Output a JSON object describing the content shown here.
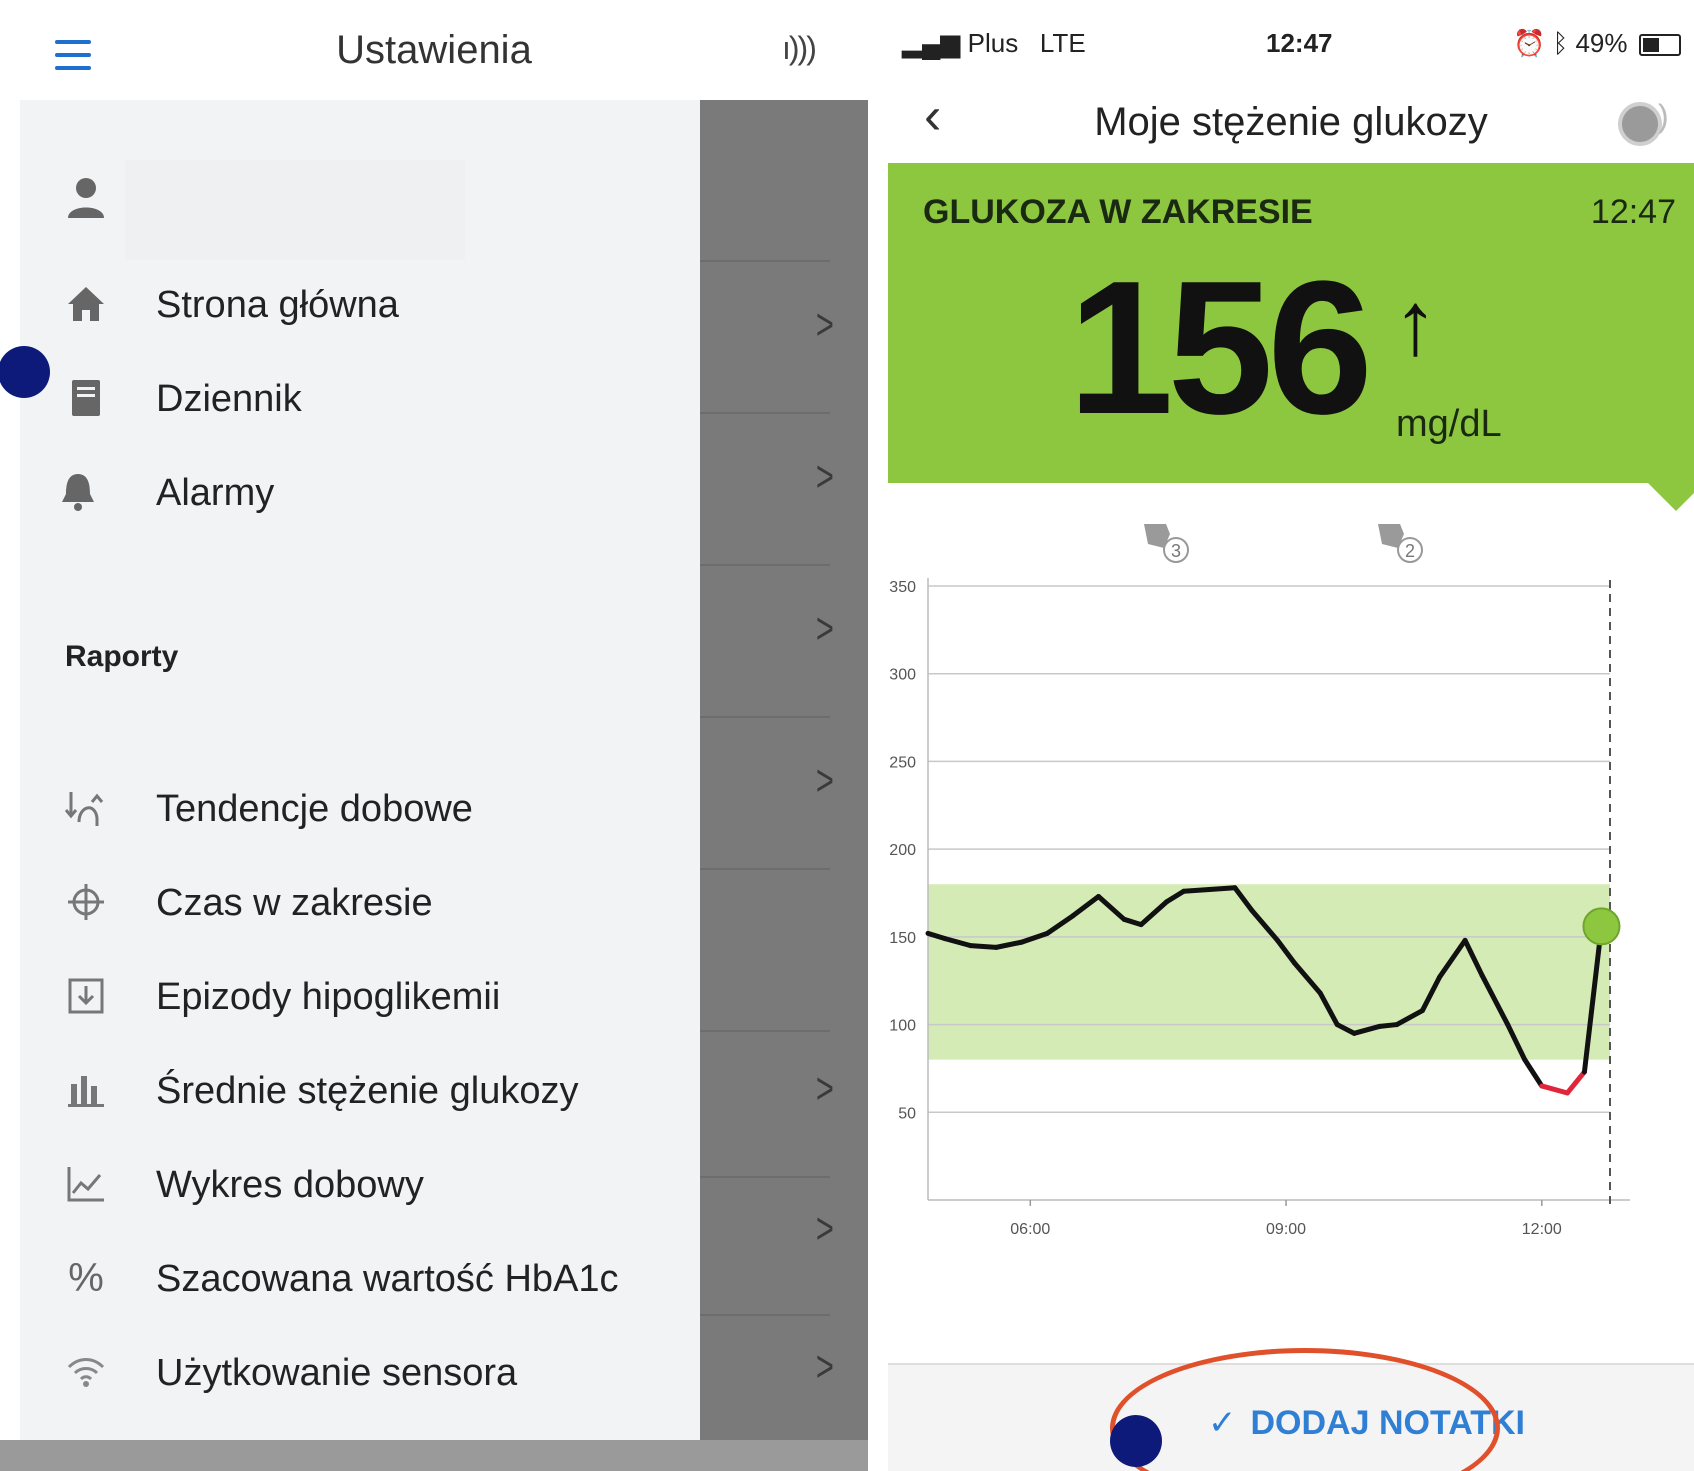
{
  "left_screen": {
    "title": "Ustawienia",
    "nfc_glyph": "ı)))",
    "menu": {
      "home": "Strona główna",
      "journal": "Dziennik",
      "alarms": "Alarmy"
    },
    "reports_header": "Raporty",
    "reports": [
      {
        "label": "Tendencje dobowe",
        "icon": "trend-icon"
      },
      {
        "label": "Czas w zakresie",
        "icon": "target-icon"
      },
      {
        "label": "Epizody hipoglikemii",
        "icon": "hypo-download-icon"
      },
      {
        "label": "Średnie stężenie glukozy",
        "icon": "bar-chart-icon"
      },
      {
        "label": "Wykres dobowy",
        "icon": "line-chart-icon"
      },
      {
        "label": "Szacowana wartość HbA1c",
        "icon": "percent-icon"
      },
      {
        "label": "Użytkowanie sensora",
        "icon": "wifi-icon"
      }
    ]
  },
  "right_screen": {
    "status_bar": {
      "carrier": "Plus",
      "network": "LTE",
      "time": "12:47",
      "battery": "49%"
    },
    "title": "Moje stężenie glukozy",
    "banner": {
      "status": "GLUKOZA W ZAKRESIE",
      "time": "12:47",
      "value": "156",
      "trend": "↑",
      "unit": "mg/dL",
      "color": "#8dc63f"
    },
    "note_markers": [
      "3",
      "2"
    ],
    "add_notes_label": "DODAJ NOTATKI"
  },
  "chart_data": {
    "type": "line",
    "ylabel": "mg/dL",
    "y_ticks": [
      50,
      100,
      150,
      200,
      250,
      300,
      350
    ],
    "ylim": [
      0,
      350
    ],
    "x_tick_labels": [
      "06:00",
      "09:00",
      "12:00"
    ],
    "x_ticks_hours": [
      6,
      9,
      12
    ],
    "xlim_hours": [
      4.8,
      12.8
    ],
    "target_range": [
      80,
      180
    ],
    "series": [
      {
        "x_hours": [
          4.8,
          5.0,
          5.3,
          5.6,
          5.9,
          6.2,
          6.5,
          6.8,
          7.1,
          7.3,
          7.6,
          7.8,
          8.1,
          8.4,
          8.6,
          8.9,
          9.1,
          9.4,
          9.6,
          9.8,
          10.1,
          10.3,
          10.6,
          10.8,
          11.1,
          11.3,
          11.6,
          11.8,
          12.0,
          12.3,
          12.5,
          12.7
        ],
        "y": [
          152,
          149,
          145,
          144,
          147,
          152,
          162,
          173,
          160,
          157,
          170,
          176,
          177,
          178,
          165,
          148,
          135,
          118,
          100,
          95,
          99,
          100,
          108,
          127,
          148,
          128,
          100,
          80,
          65,
          61,
          73,
          156
        ]
      }
    ],
    "low_segment_color": "#e0263a",
    "line_color": "#111111",
    "range_color": "#d4ebb6"
  }
}
